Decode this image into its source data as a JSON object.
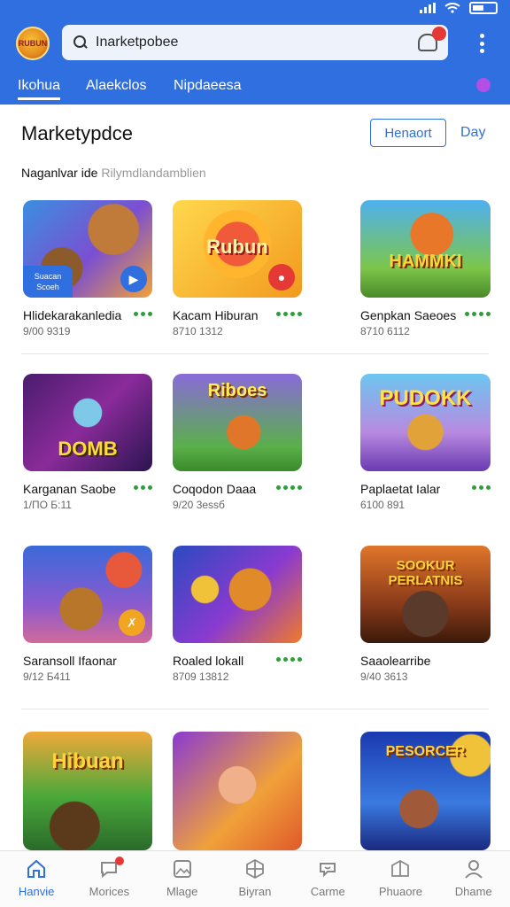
{
  "header": {
    "logo_text": "RUBUN",
    "search": {
      "value": "Inarketpobee",
      "placeholder": ""
    },
    "cart_badge": "",
    "tabs": [
      {
        "label": "Ikohua",
        "active": true
      },
      {
        "label": "Alaekclos",
        "active": false
      },
      {
        "label": "Nipdaeesa",
        "active": false
      }
    ],
    "accent": "#2f6fe0"
  },
  "main": {
    "title": "Marketypdce",
    "filter_button": "Henaort",
    "day_link": "Day",
    "subtitle_main": "Naganlvar ide",
    "subtitle_hint": "Rilymdlandamblien"
  },
  "cards": [
    {
      "art": "Bear friends",
      "title_art": "",
      "name": "Hlidekarakanledia",
      "meta": "9/00 9319",
      "corner": "badge",
      "corner_text": "Suacan Scoeh"
    },
    {
      "art": "Rubun",
      "title_art": "Rubun",
      "name": "Kacam Hiburan",
      "meta": "8710 1312",
      "corner": "red",
      "corner_text": ""
    },
    {
      "art": "Hammki",
      "title_art": "HAMMKI",
      "name": "Genpkan Saeoes",
      "meta": "8710 6112",
      "corner": "",
      "corner_text": ""
    },
    {
      "art": "Domb",
      "title_art": "DOMB",
      "name": "Karganan Saobe",
      "meta": "1/ПО Б:11",
      "corner": "",
      "corner_text": ""
    },
    {
      "art": "Riboes",
      "title_art": "Riboes",
      "name": "Coqodon Daaa",
      "meta": "9/20 3essб",
      "corner": "",
      "corner_text": ""
    },
    {
      "art": "Pudokk",
      "title_art": "PUDOKK",
      "name": "Paplaetat Ialar",
      "meta": "6100 891",
      "corner": "",
      "corner_text": ""
    },
    {
      "art": "Balloon bear",
      "title_art": "",
      "name": "Saransoll Ifaonar",
      "meta": "9/12 Б411",
      "corner": "orange",
      "corner_text": ""
    },
    {
      "art": "Rohed bear",
      "title_art": "",
      "name": "Roaled lokall",
      "meta": "8709 13812",
      "corner": "",
      "corner_text": ""
    },
    {
      "art": "Tribe",
      "title_art": "SOOKUR PERLATNIS",
      "name": "Saaolearribe",
      "meta": "9/40 3613",
      "corner": "",
      "corner_text": ""
    },
    {
      "art": "Hibuan",
      "title_art": "Hibuan",
      "name": "",
      "meta": "",
      "corner": "",
      "corner_text": ""
    },
    {
      "art": "Hero",
      "title_art": "",
      "name": "",
      "meta": "",
      "corner": "",
      "corner_text": ""
    },
    {
      "art": "Pesorcer",
      "title_art": "PESORCER",
      "name": "",
      "meta": "",
      "corner": "",
      "corner_text": ""
    }
  ],
  "bottom_nav": [
    {
      "label": "Hanvie",
      "icon": "home-icon",
      "active": true
    },
    {
      "label": "Morices",
      "icon": "chat-icon",
      "active": false,
      "badge": true
    },
    {
      "label": "Mlage",
      "icon": "image-icon",
      "active": false
    },
    {
      "label": "Biyran",
      "icon": "cube-icon",
      "active": false
    },
    {
      "label": "Carme",
      "icon": "game-icon",
      "active": false
    },
    {
      "label": "Phuaore",
      "icon": "store-icon",
      "active": false
    },
    {
      "label": "Dhame",
      "icon": "profile-icon",
      "active": false
    }
  ]
}
